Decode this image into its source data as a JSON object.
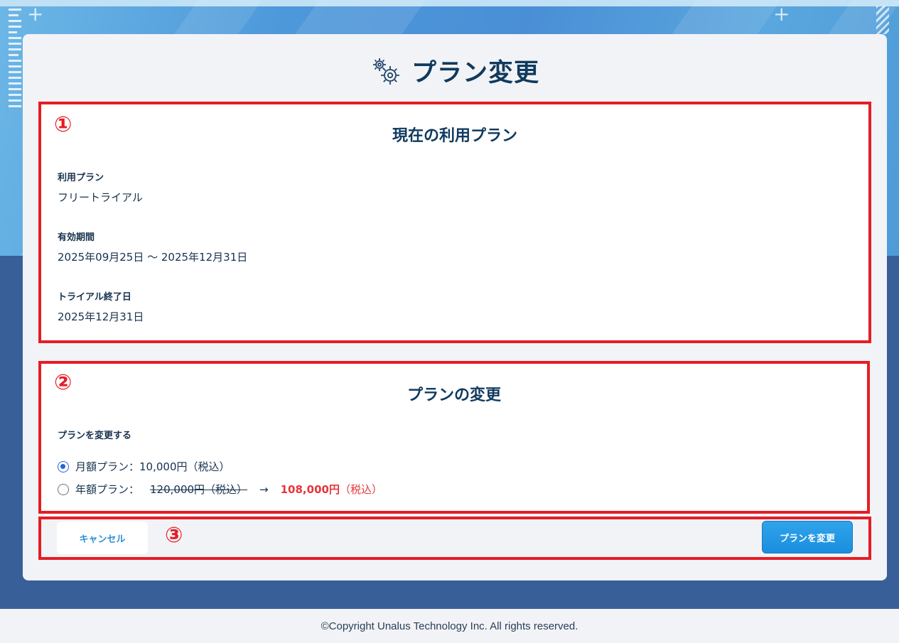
{
  "page": {
    "title": "プラン変更"
  },
  "markers": {
    "one": "①",
    "two": "②",
    "three": "③"
  },
  "current_plan": {
    "heading": "現在の利用プラン",
    "plan_label": "利用プラン",
    "plan_value": "フリートライアル",
    "period_label": "有効期間",
    "period_value": "2025年09月25日 〜 2025年12月31日",
    "trial_end_label": "トライアル終了日",
    "trial_end_value": "2025年12月31日"
  },
  "change_plan": {
    "heading": "プランの変更",
    "field_label": "プランを変更する",
    "options": [
      {
        "label": "月額プラン：10,000円（税込）",
        "selected": true
      },
      {
        "label": "年額プラン：",
        "old_price": "120,000円（税込）",
        "arrow": "→",
        "new_price": "108,000円",
        "new_price_tax": "（税込）",
        "selected": false
      }
    ]
  },
  "actions": {
    "cancel_label": "キャンセル",
    "submit_label": "プランを変更"
  },
  "footer": {
    "copyright": "©Copyright Unalus Technology Inc. All rights reserved."
  },
  "colors": {
    "accent": "#2a8fd8",
    "highlight_border": "#e51d25",
    "discount_price": "#e5353b",
    "heading": "#103a5e",
    "lower_background": "#385f98"
  },
  "icons": {
    "title_icon": "gears-icon"
  }
}
